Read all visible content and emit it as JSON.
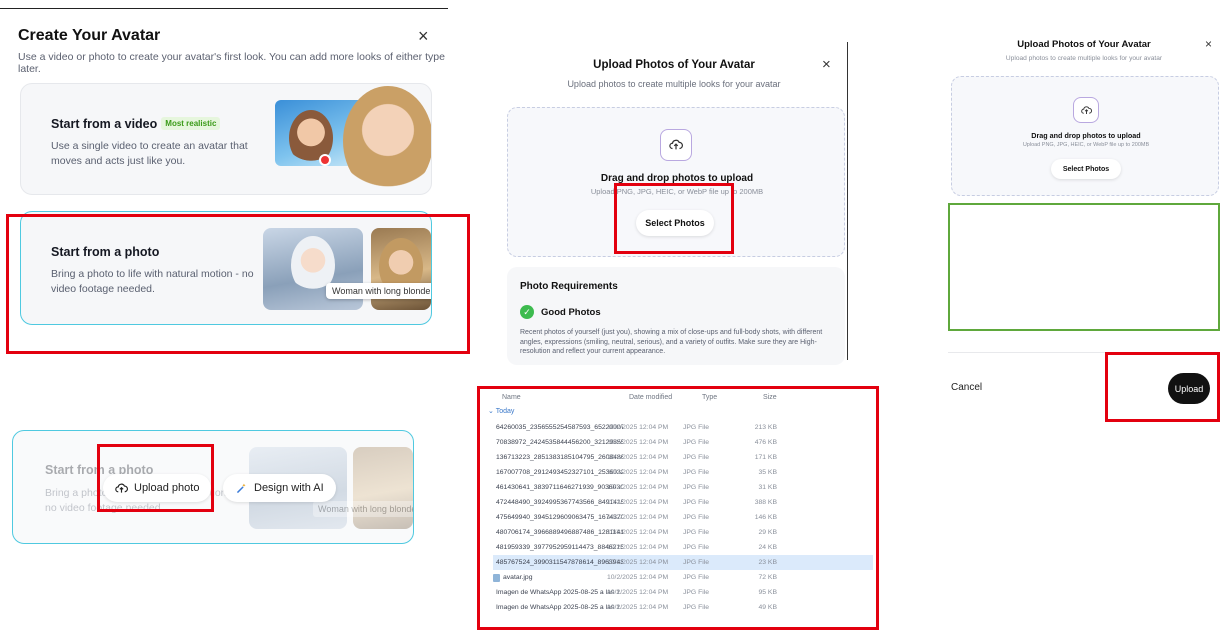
{
  "panel_create": {
    "title": "Create Your Avatar",
    "close": "×",
    "subtitle": "Use a video or photo to create your avatar's first look. You can add more looks of either type later.",
    "video_card": {
      "title": "Start from a video",
      "badge": "Most realistic",
      "desc": "Use a single video to create an avatar that moves and acts just like you."
    },
    "photo_card": {
      "title": "Start from a photo",
      "desc": "Bring a photo to life with natural motion - no video footage needed.",
      "tooltip": "Woman with long blonde hai"
    },
    "hover_card": {
      "title": "Start from a photo",
      "desc": "Bring a photo to life with natural motion - no video footage needed.",
      "upload_label": "Upload photo",
      "design_label": "Design with AI",
      "tooltip": "Woman with long blonde hair"
    }
  },
  "panel_upload": {
    "title": "Upload Photos of Your Avatar",
    "close": "×",
    "subtitle": "Upload photos to create multiple looks for your avatar",
    "drop_title": "Drag and drop photos to upload",
    "drop_hint": "Upload PNG, JPG, HEIC, or WebP file up to 200MB",
    "select_label": "Select Photos",
    "req_title": "Photo Requirements",
    "good_label": "Good Photos",
    "good_desc": "Recent photos of yourself (just you), showing a mix of close-ups and full-body shots, with different angles, expressions (smiling, neutral, serious), and a variety of outfits. Make sure they are High-resolution and reflect your current appearance."
  },
  "explorer": {
    "headers": {
      "name": "Name",
      "date": "Date modified",
      "type": "Type",
      "size": "Size"
    },
    "group": "Today",
    "files": [
      {
        "name": "64260035_2356555254587593_65220007...",
        "date": "10/2/2025 12:04 PM",
        "type": "JPG File",
        "size": "213 KB"
      },
      {
        "name": "70838972_2424535844456200_32129855...",
        "date": "10/2/2025 12:04 PM",
        "type": "JPG File",
        "size": "476 KB"
      },
      {
        "name": "136713223_2851383185104795_2608486...",
        "date": "10/2/2025 12:04 PM",
        "type": "JPG File",
        "size": "171 KB"
      },
      {
        "name": "167007708_2912493452327101_2536032...",
        "date": "10/2/2025 12:04 PM",
        "type": "JPG File",
        "size": "35 KB"
      },
      {
        "name": "461430641_3839711646271939_9036030...",
        "date": "10/2/2025 12:04 PM",
        "type": "JPG File",
        "size": "31 KB"
      },
      {
        "name": "472448490_3924995367743566_8491415...",
        "date": "10/2/2025 12:04 PM",
        "type": "JPG File",
        "size": "388 KB"
      },
      {
        "name": "475649940_3945129609063475_1674370...",
        "date": "10/2/2025 12:04 PM",
        "type": "JPG File",
        "size": "146 KB"
      },
      {
        "name": "480706174_3966889496887486_1281141...",
        "date": "10/2/2025 12:04 PM",
        "type": "JPG File",
        "size": "29 KB"
      },
      {
        "name": "481959339_3977952959114473_8846215...",
        "date": "10/2/2025 12:04 PM",
        "type": "JPG File",
        "size": "24 KB"
      },
      {
        "name": "485767524_3990311547878614_8963943...",
        "date": "10/2/2025 12:04 PM",
        "type": "JPG File",
        "size": "23 KB"
      },
      {
        "name": "avatar.jpg",
        "date": "10/2/2025 12:04 PM",
        "type": "JPG File",
        "size": "72 KB"
      },
      {
        "name": "Imagen de WhatsApp 2025-08-25 a las 1...",
        "date": "10/2/2025 12:04 PM",
        "type": "JPG File",
        "size": "95 KB"
      },
      {
        "name": "Imagen de WhatsApp 2025-08-25 a las 1...",
        "date": "10/2/2025 12:04 PM",
        "type": "JPG File",
        "size": "49 KB"
      }
    ]
  },
  "panel_upload_small": {
    "title": "Upload Photos of Your Avatar",
    "close": "×",
    "subtitle": "Upload photos to create multiple looks for your avatar",
    "drop_title": "Drag and drop photos to upload",
    "drop_hint": "Upload PNG, JPG, HEIC, or WebP file up to 200MB",
    "select_label": "Select Photos",
    "cancel_label": "Cancel",
    "upload_label": "Upload"
  },
  "colors": {
    "highlight_red": "#e3000f",
    "highlight_green": "#5fa83c",
    "accent_cyan": "#4fc9e0"
  }
}
